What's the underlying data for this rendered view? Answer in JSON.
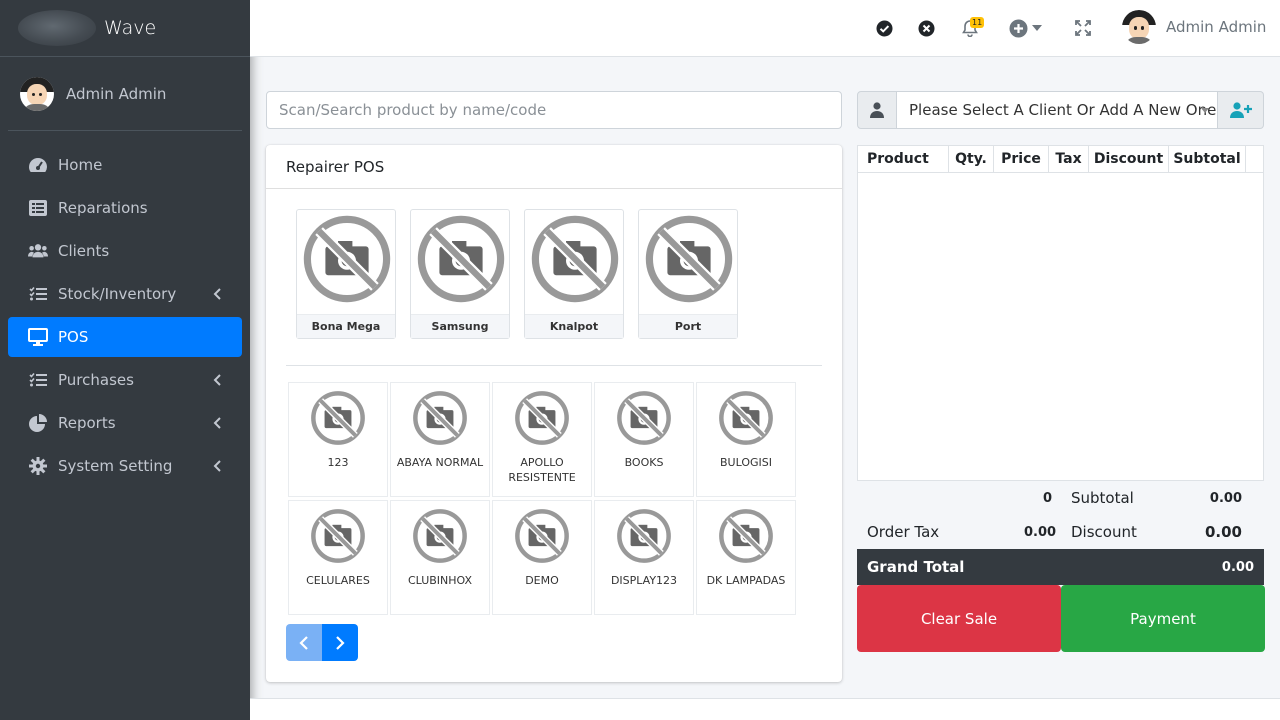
{
  "app": {
    "brand": "Wave"
  },
  "sidebar": {
    "user": "Admin Admin",
    "items": [
      {
        "label": "Home",
        "icon": "dashboard-icon"
      },
      {
        "label": "Reparations",
        "icon": "list-icon"
      },
      {
        "label": "Clients",
        "icon": "users-icon"
      },
      {
        "label": "Stock/Inventory",
        "icon": "tasks-icon"
      },
      {
        "label": "POS",
        "icon": "desktop-icon"
      },
      {
        "label": "Purchases",
        "icon": "tasks-icon"
      },
      {
        "label": "Reports",
        "icon": "pie-chart-icon"
      },
      {
        "label": "System Setting",
        "icon": "gear-icon"
      }
    ]
  },
  "header": {
    "user": "Admin Admin",
    "notifications": "11"
  },
  "search": {
    "placeholder": "Scan/Search product by name/code"
  },
  "products_card": {
    "title": "Repairer POS",
    "categories": [
      "Bona Mega",
      "Samsung",
      "Knalpot",
      "Port"
    ],
    "products": [
      "123",
      "ABAYA NORMAL",
      "APOLLO RESISTENTE",
      "BOOKS",
      "BULOGISI",
      "CELULARES",
      "CLUBINHOX",
      "DEMO",
      "DISPLAY123",
      "DK LAMPADAS"
    ]
  },
  "client": {
    "placeholder": "Please Select A Client Or Add A New One"
  },
  "cart": {
    "columns": [
      "Product",
      "Qty.",
      "Price",
      "Tax",
      "Discount",
      "Subtotal"
    ]
  },
  "totals": {
    "items_count": "0",
    "subtotal_label": "Subtotal",
    "subtotal_value": "0.00",
    "order_tax_label": "Order Tax",
    "order_tax_value": "0.00",
    "discount_label": "Discount",
    "discount_value": "0.00",
    "grand_total_label": "Grand Total",
    "grand_total_value": "0.00"
  },
  "actions": {
    "clear": "Clear Sale",
    "payment": "Payment"
  },
  "colors": {
    "primary": "#007bff",
    "danger": "#dc3545",
    "success": "#28a745",
    "sidebar": "#343a40"
  }
}
